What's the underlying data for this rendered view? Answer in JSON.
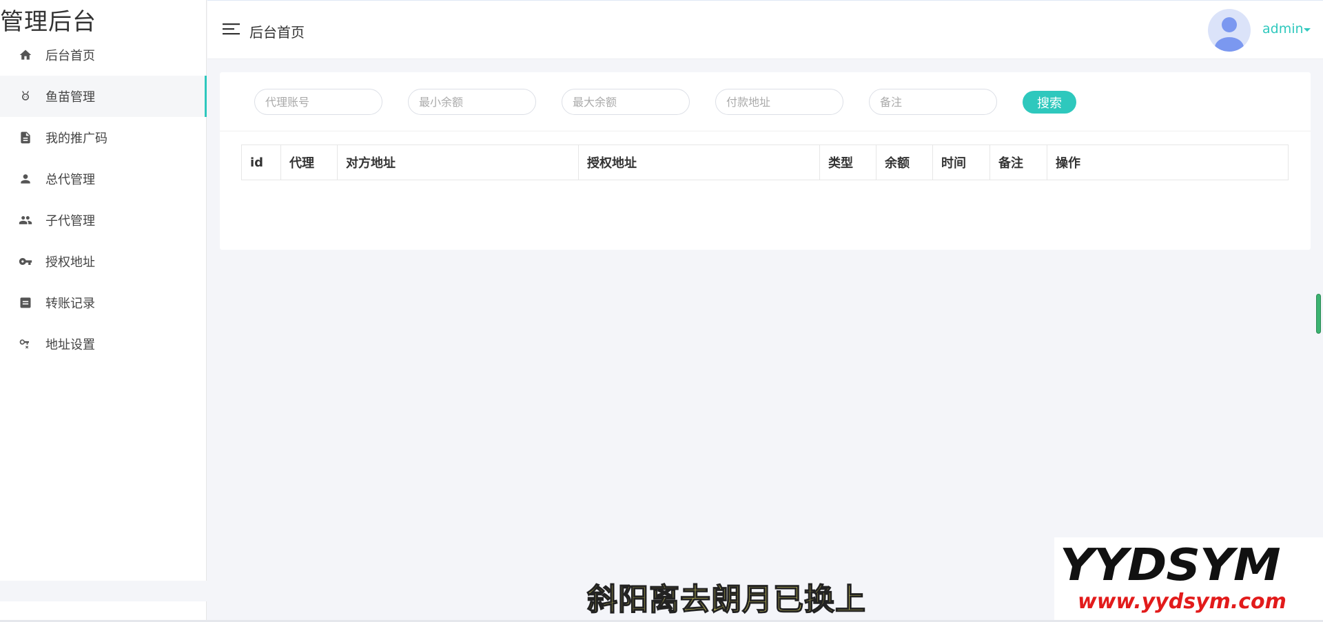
{
  "brand": {
    "title": "管理后台"
  },
  "sidebar": {
    "items": [
      {
        "label": "后台首页",
        "icon": "home-icon"
      },
      {
        "label": "鱼苗管理",
        "icon": "fish-icon",
        "active": true
      },
      {
        "label": "我的推广码",
        "icon": "document-icon"
      },
      {
        "label": "总代管理",
        "icon": "person-icon"
      },
      {
        "label": "子代管理",
        "icon": "people-icon"
      },
      {
        "label": "授权地址",
        "icon": "key-icon"
      },
      {
        "label": "转账记录",
        "icon": "list-icon"
      },
      {
        "label": "地址设置",
        "icon": "key-settings-icon"
      }
    ]
  },
  "header": {
    "title": "后台首页",
    "user": "admin",
    "accent": "#2ec8bd"
  },
  "filters": {
    "agent_placeholder": "代理账号",
    "min_balance_placeholder": "最小余额",
    "max_balance_placeholder": "最大余额",
    "pay_address_placeholder": "付款地址",
    "remark_placeholder": "备注",
    "search_label": "搜索"
  },
  "table": {
    "columns": [
      "id",
      "代理",
      "对方地址",
      "授权地址",
      "类型",
      "余额",
      "时间",
      "备注",
      "操作"
    ]
  },
  "overlay": {
    "subtitle": "斜阳离去朗月已换上",
    "watermark_brand": "YYDSYM",
    "watermark_url": "www.yydsym.com"
  }
}
